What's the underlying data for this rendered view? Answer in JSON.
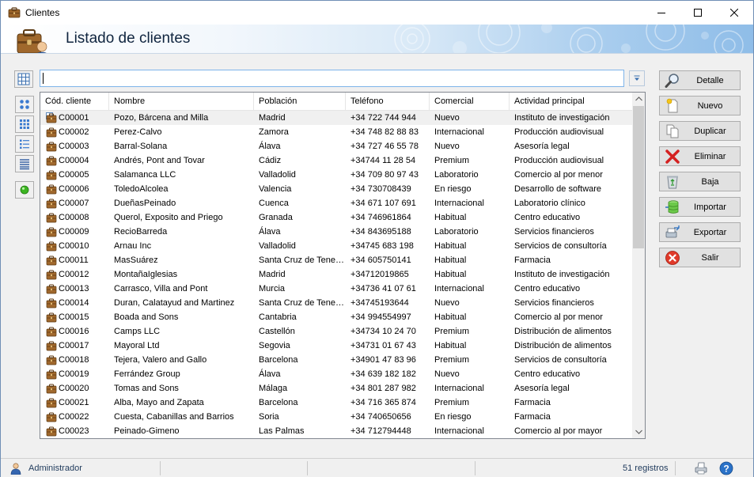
{
  "window": {
    "title": "Clientes",
    "header_title": "Listado de clientes"
  },
  "search": {
    "value": "",
    "placeholder": ""
  },
  "grid": {
    "columns": [
      "Cód. cliente",
      "Nombre",
      "Población",
      "Teléfono",
      "Comercial",
      "Actividad principal"
    ],
    "rows": [
      [
        "C00001",
        "Pozo, Bárcena and Milla",
        "Madrid",
        "+34 722 744 944",
        "Nuevo",
        "Instituto de investigación"
      ],
      [
        "C00002",
        "Perez-Calvo",
        "Zamora",
        "+34 748 82 88 83",
        "Internacional",
        "Producción audiovisual"
      ],
      [
        "C00003",
        "Barral-Solana",
        "Álava",
        "+34 727 46 55 78",
        "Nuevo",
        "Asesoría legal"
      ],
      [
        "C00004",
        "Andrés, Pont and Tovar",
        "Cádiz",
        "+34744 11 28 54",
        "Premium",
        "Producción audiovisual"
      ],
      [
        "C00005",
        "Salamanca LLC",
        "Valladolid",
        "+34 709 80 97 43",
        "Laboratorio",
        "Comercio al por menor"
      ],
      [
        "C00006",
        "ToledoAlcolea",
        "Valencia",
        "+34 730708439",
        "En riesgo",
        "Desarrollo de software"
      ],
      [
        "C00007",
        "DueñasPeinado",
        "Cuenca",
        "+34 671 107 691",
        "Internacional",
        "Laboratorio clínico"
      ],
      [
        "C00008",
        "Querol, Exposito and Priego",
        "Granada",
        "+34 746961864",
        "Habitual",
        "Centro educativo"
      ],
      [
        "C00009",
        "RecioBarreda",
        "Álava",
        "+34 843695188",
        "Laboratorio",
        "Servicios financieros"
      ],
      [
        "C00010",
        "Arnau Inc",
        "Valladolid",
        "+34745 683 198",
        "Habitual",
        "Servicios de consultoría"
      ],
      [
        "C00011",
        "MasSuárez",
        "Santa Cruz de Tenerife",
        "+34 605750141",
        "Habitual",
        "Farmacia"
      ],
      [
        "C00012",
        "MontañaIglesias",
        "Madrid",
        "+34712019865",
        "Habitual",
        "Instituto de investigación"
      ],
      [
        "C00013",
        "Carrasco, Villa and Pont",
        "Murcia",
        "+34736 41 07 61",
        "Internacional",
        "Centro educativo"
      ],
      [
        "C00014",
        "Duran, Calatayud and Martinez",
        "Santa Cruz de Tenerife",
        "+34745193644",
        "Nuevo",
        "Servicios financieros"
      ],
      [
        "C00015",
        "Boada and Sons",
        "Cantabria",
        "+34 994554997",
        "Habitual",
        "Comercio al por menor"
      ],
      [
        "C00016",
        "Camps LLC",
        "Castellón",
        "+34734 10 24 70",
        "Premium",
        "Distribución de alimentos"
      ],
      [
        "C00017",
        "Mayoral Ltd",
        "Segovia",
        "+34731 01 67 43",
        "Habitual",
        "Distribución de alimentos"
      ],
      [
        "C00018",
        "Tejera, Valero and Gallo",
        "Barcelona",
        "+34901 47 83 96",
        "Premium",
        "Servicios de consultoría"
      ],
      [
        "C00019",
        "Ferrández Group",
        "Álava",
        "+34 639 182 182",
        "Nuevo",
        "Centro educativo"
      ],
      [
        "C00020",
        "Tomas and Sons",
        "Málaga",
        "+34 801 287 982",
        "Internacional",
        "Asesoría legal"
      ],
      [
        "C00021",
        "Alba, Mayo and Zapata",
        "Barcelona",
        "+34 716 365 874",
        "Premium",
        "Farmacia"
      ],
      [
        "C00022",
        "Cuesta, Cabanillas and Barrios",
        "Soria",
        "+34 740650656",
        "En riesgo",
        "Farmacia"
      ],
      [
        "C00023",
        "Peinado-Gimeno",
        "Las Palmas",
        "+34 712794448",
        "Internacional",
        "Comercio al por mayor"
      ]
    ]
  },
  "actions": {
    "detalle": "Detalle",
    "nuevo": "Nuevo",
    "duplicar": "Duplicar",
    "eliminar": "Eliminar",
    "baja": "Baja",
    "importar": "Importar",
    "exportar": "Exportar",
    "salir": "Salir"
  },
  "status": {
    "user": "Administrador",
    "count": "51 registros"
  },
  "icons": {
    "app": "briefcase-icon",
    "header": "briefcase-user-icon",
    "row": "briefcase-icon",
    "row_selected": "grid-briefcase-icon"
  },
  "colors": {
    "accent": "#7eb4ea",
    "selected_row": "#f0f0f0",
    "status_text": "#1e395b",
    "green_dot": "#3cb521"
  }
}
